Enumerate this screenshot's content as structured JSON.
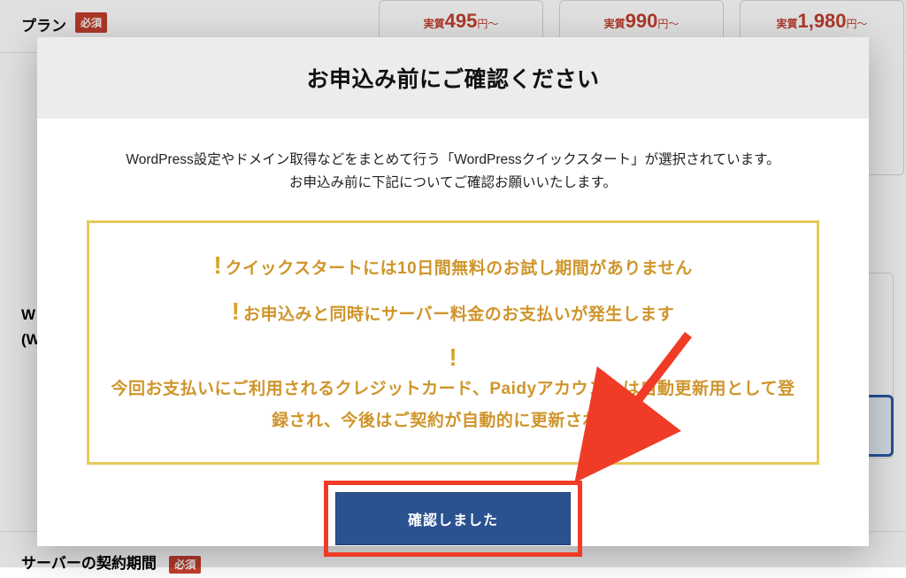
{
  "bg": {
    "plan_label": "プラン",
    "required_badge": "必須",
    "prices": [
      {
        "prefix": "実質",
        "num": "495",
        "suffix": "円〜"
      },
      {
        "prefix": "実質",
        "num": "990",
        "suffix": "円〜"
      },
      {
        "prefix": "実質",
        "num": "1,980",
        "suffix": "円〜"
      }
    ],
    "row2_t1": "W",
    "row2_t2": "(W",
    "row3_label": "サーバーの契約期間",
    "row3_badge": "必須"
  },
  "modal": {
    "title": "お申込み前にご確認ください",
    "intro_line1": "WordPress設定やドメイン取得などをまとめて行う「WordPressクイックスタート」が選択されています。",
    "intro_line2": "お申込み前に下記についてご確認お願いいたします。",
    "warnings": [
      "クイックスタートには10日間無料のお試し期間がありません",
      "お申込みと同時にサーバー料金のお支払いが発生します",
      "今回お支払いにご利用されるクレジットカード、Paidyアカウントは自動更新用として登録され、今後はご契約が自動的に更新されます"
    ],
    "confirm_label": "確認しました"
  },
  "colors": {
    "accent_red": "#c43f2e",
    "accent_blue": "#2b5aa8",
    "warn_gold": "#cf952b",
    "highlight_red": "#f03b26"
  }
}
